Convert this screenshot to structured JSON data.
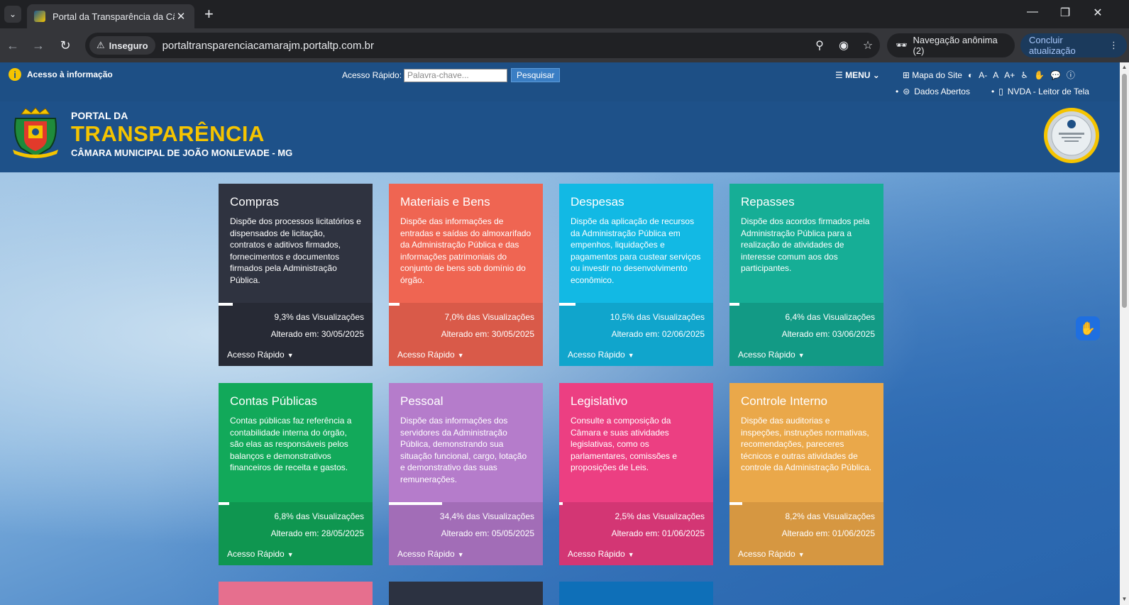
{
  "browser": {
    "tab_title": "Portal da Transparência da Câm",
    "insecure_label": "Inseguro",
    "url": "portaltransparenciacamarajm.portaltp.com.br",
    "incognito_label": "Navegação anônima (2)",
    "update_label": "Concluir atualização"
  },
  "accessibility_bar": {
    "info_label": "Acesso à informação",
    "quick_access_label": "Acesso Rápido:",
    "search_placeholder": "Palavra-chave...",
    "search_button": "Pesquisar",
    "menu_label": "MENU",
    "sitemap_label": "Mapa do Site",
    "font_decrease": "A-",
    "font_normal": "A",
    "font_increase": "A+",
    "open_data_label": "Dados Abertos",
    "nvda_label": "NVDA - Leitor de Tela"
  },
  "header": {
    "portal_label": "PORTAL DA",
    "title": "TRANSPARÊNCIA",
    "subtitle": "CÂMARA MUNICIPAL DE JOÃO MONLEVADE - MG"
  },
  "cards": [
    {
      "title": "Compras",
      "desc": "Dispõe dos processos licitatórios e dispensados de licitação, contratos e aditivos firmados, fornecimentos e documentos firmados pela Administração Pública.",
      "views": "9,3% das Visualizações",
      "views_fraction": 0.093,
      "altered": "Alterado em: 30/05/2025",
      "quick": "Acesso Rápido",
      "color_top": "#2f3340",
      "color_bottom": "#272a35"
    },
    {
      "title": "Materiais e Bens",
      "desc": "Dispõe das informações de entradas e saídas do almoxarifado da Administração Pública e das informações patrimoniais do conjunto de bens sob domínio do órgão.",
      "views": "7,0% das Visualizações",
      "views_fraction": 0.07,
      "altered": "Alterado em: 30/05/2025",
      "quick": "Acesso Rápido",
      "color_top": "#ef6552",
      "color_bottom": "#d95a49"
    },
    {
      "title": "Despesas",
      "desc": "Dispõe da aplicação de recursos da Administração Pública em empenhos, liquidações e pagamentos para custear serviços ou investir no desenvolvimento econômico.",
      "views": "10,5% das Visualizações",
      "views_fraction": 0.105,
      "altered": "Alterado em: 02/06/2025",
      "quick": "Acesso Rápido",
      "color_top": "#12b9e4",
      "color_bottom": "#10a5cc"
    },
    {
      "title": "Repasses",
      "desc": "Dispõe dos acordos firmados pela Administração Pública para a realização de atividades de interesse comum aos dos participantes.",
      "views": "6,4% das Visualizações",
      "views_fraction": 0.064,
      "altered": "Alterado em: 03/06/2025",
      "quick": "Acesso Rápido",
      "color_top": "#16ae96",
      "color_bottom": "#129a85"
    },
    {
      "title": "Contas Públicas",
      "desc": "Contas públicas faz referência a contabilidade interna do órgão, são elas as responsáveis pelos balanços e demonstrativos financeiros de receita e gastos.",
      "views": "6,8% das Visualizações",
      "views_fraction": 0.068,
      "altered": "Alterado em: 28/05/2025",
      "quick": "Acesso Rápido",
      "color_top": "#12a95a",
      "color_bottom": "#0f9650"
    },
    {
      "title": "Pessoal",
      "desc": "Dispõe das informações dos servidores da Administração Pública, demonstrando sua situação funcional, cargo, lotação e demonstrativo das suas remunerações.",
      "views": "34,4% das Visualizações",
      "views_fraction": 0.344,
      "altered": "Alterado em: 05/05/2025",
      "quick": "Acesso Rápido",
      "color_top": "#b57ccb",
      "color_bottom": "#a26db7"
    },
    {
      "title": "Legislativo",
      "desc": "Consulte a composição da Câmara e suas atividades legislativas, como os parlamentares, comissões e proposições de Leis.",
      "views": "2,5% das Visualizações",
      "views_fraction": 0.025,
      "altered": "Alterado em: 01/06/2025",
      "quick": "Acesso Rápido",
      "color_top": "#ec3f82",
      "color_bottom": "#d33674"
    },
    {
      "title": "Controle Interno",
      "desc": "Dispõe das auditorias e inspeções, instruções normativas, recomendações, pareceres técnicos e outras atividades de controle da Administração Pública.",
      "views": "8,2% das Visualizações",
      "views_fraction": 0.082,
      "altered": "Alterado em: 01/06/2025",
      "quick": "Acesso Rápido",
      "color_top": "#eaa84a",
      "color_bottom": "#d69741"
    }
  ],
  "partial_cards": [
    {
      "color": "#e66f8e"
    },
    {
      "color": "#2c3241"
    },
    {
      "color": "#0e6fb8"
    }
  ]
}
